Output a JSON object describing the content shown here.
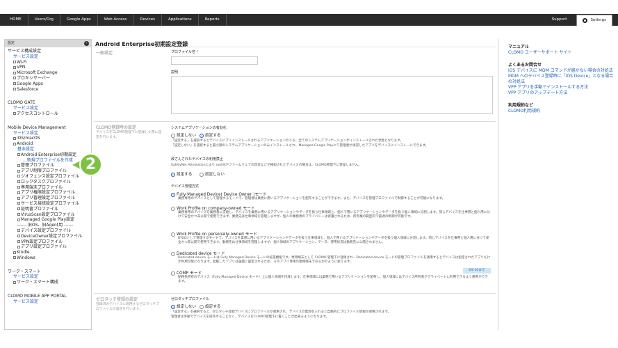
{
  "nav": {
    "items": [
      "HOME",
      "Users/Org",
      "Google Apps",
      "Web Access",
      "Devices",
      "Applications",
      "Reports"
    ],
    "support": "Support",
    "settings": "Settings"
  },
  "sidebar": {
    "header": "設定",
    "groups": [
      {
        "title": "サービス構成設定",
        "link": "サービス設定",
        "items": [
          "Wi-Fi",
          "VPN",
          "Microsoft Exchange",
          "プロキシサーバー",
          "Google Apps",
          "Salesforce"
        ]
      },
      {
        "title": "CLOMO GATE",
        "link": "サービス設定",
        "items": [
          "アクセスコントロール"
        ]
      },
      {
        "title": "Mobile Device Management",
        "link": "サービス設定",
        "items": [
          "iOS/macOS",
          "Android"
        ]
      }
    ],
    "android": {
      "basic": "基本設定",
      "enterprise": "Android Enterprise初期設定",
      "new_profile": "...新規プロファイルを作成",
      "profiles": [
        "管理プロファイル",
        "アプリ制限プロファイル",
        "ジオフェンス設定プロファイル",
        "ロックタスクプロファイル",
        "専用端末プロファイル",
        "アプリ権限設定プロファイル",
        "アプリ管理設定プロファイル",
        "サービス接続設定プロファイル",
        "証明書プロファイル",
        "VirusScan設定プロファイル",
        "Managed Google Play設定"
      ],
      "legacy": "------ 旧OS、旧Agent用 ------",
      "legacy_profiles": [
        "デバイス設定プロファイル",
        "DeviceOwner設定プロファイル",
        "VPN設定プロファイル",
        "アプリ設定プロファイル"
      ]
    },
    "after": [
      "Kindle",
      "Windows"
    ],
    "workstyle": {
      "title": "ワーク・スマート",
      "link": "サービス設定",
      "items": [
        "ワーク・スマート構成"
      ]
    },
    "portal": {
      "title": "CLOMO MOBILE APP PORTAL",
      "link": "サービス設定"
    }
  },
  "callout_number": "2",
  "main": {
    "title": "Android Enterprise初期設定登録",
    "general": {
      "label": "一般設定",
      "profile_name_label": "プロファイル名",
      "required_mark": "*",
      "description_label": "説明"
    },
    "clomo": {
      "label": "CLOMO登録時の設定",
      "desc": "デバイスをCLOMO管理下に登録した際に設定を行います。",
      "sys_apps_label": "システムアプリケーションの有効化",
      "no": "設定しない",
      "yes": "設定する",
      "sys_note1": "「設定する」を選択するとデバイスにプリインストールされるアプリケーションのうち、全てのシステムアプリケーションがインストールされた状態となります。",
      "sys_note2": "「設定しない」を選択すると最小限のシステムアプリケーションのみインストールされ、Managed Google Playにて管理者が承認したアプリをデバイスにインストールできます。",
      "tamper_label": "改ざんされたデバイスの利用禁止",
      "tamper_note": "SafetyNet Attestationにより root化やファームウェアの改変などが検知されたデバイスの場合は、CLOMO管理下に登録しません。",
      "mode_label": "デバイス管理方式",
      "modes": [
        {
          "title": "Fully Managed Device( Device Owner )モード",
          "desc": "業務専用のデバイスとして管理するモードで、管理者は業務に用いるアプリケーションを配布することができます。また、デバイスを管理プロファイルで制御することが可能になります。"
        },
        {
          "title": "Work Profile on company-owned モード",
          "desc": "業務専用のデバイスを業務者に支給し、デバイスを業務に用いるアプリケーションやデータを扱う仕事領域と、個人で用いるアプリケーションやデータを扱う個人領域に分割します。同じデバイスを仕事用と個人用に分けて安全かつ非公開で使用できます。業務先は仕事領域を管理しますが、個人の業務者のプライバシーは保護されるため、所有権の範囲内で最適の制御が可能です。"
        },
        {
          "title": "Work Profile on personally-owned モード",
          "desc": "BYODとして管理するモードで、デバイスを業務に用いるアプリケーションやデータを扱う仕事領域と、個人で用いるアプリケーションやデータを扱う個人領域に分割します。同じデバイスを仕事用と個人用に分けて安全かつ非公開で使用できます。勤務先は仕事領域を管理しますが、個人領域のアプリケーション、データ、使用状況は勤務先に公開されません。"
        },
        {
          "title": "Dedicated device モード",
          "desc": "Dedicated device モードは Fully Managed Device モードの拡張機能です。専用端末として CLOMO 管理下に登録され、Dedicated device モードの管理プロファイルを適用するとデバイスは指定されたアプリだけが利用可能になります。起動したアプリは画面に固定されるため、そのアプリ専用の業務端末であるかのように扱えます。"
        },
        {
          "title": "COMP モード",
          "desc": "勤務先所有のデバイス（Fully Managed Device モード）上に個人領域を作成します。仕事領域には業務で用いるアプリケーションを配布し、個人領域にはデバイス所有者がプライベートに利用できるよう運用ができます。"
        }
      ],
      "os_badge": "OS 10まで"
    },
    "zerotouch": {
      "label": "ゼロタッチ登録の設定",
      "desc": "登録済みデバイスに適用するゼロタッチプロファイルの設定を行います。",
      "field_label": "ゼロタッチプロファイル",
      "note1": "「設定する」を選択すると、ゼロタッチ登録デバイスにプロファイルが適用され、デバイスの電源を入れると自動的にプロファイル情報が適用されます。",
      "note2": "管理者は手動でデバイスを操作することなく、デバイスをCLOMO管理下に置くことが出来るようになります。"
    }
  },
  "right": {
    "manual_head": "マニュアル",
    "manual_link": "CLOMO ユーザーサポート サイト",
    "faq_head": "よくあるお問合せ",
    "faq_links": [
      "iOS デバイスに MDM コマンドが届かない場合の対処法",
      "MDM へのデバイス登録時に「iOS Device」となる場合の対処法",
      "VPP アプリを手動でインストールする方法",
      "VPP アプリのアップデート方法"
    ],
    "terms_head": "利用規約など",
    "terms_link": "CLOMO利用規約"
  }
}
